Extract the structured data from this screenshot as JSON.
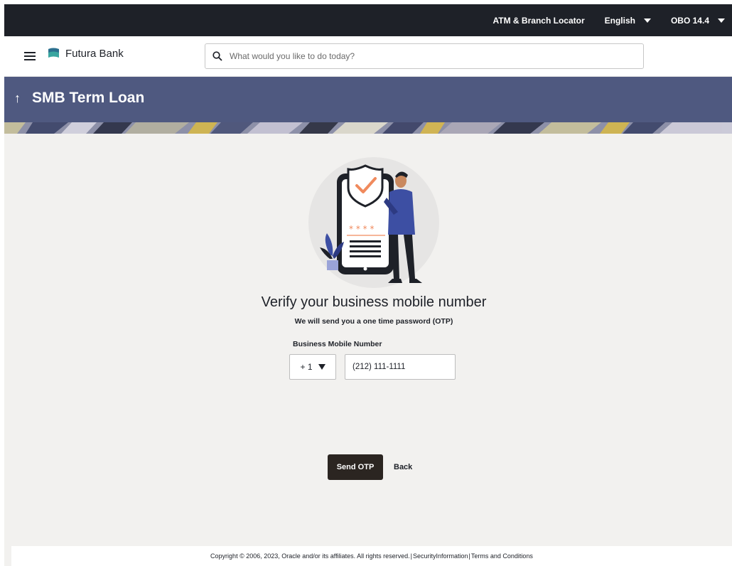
{
  "topbar": {
    "atm_locator": "ATM & Branch Locator",
    "language": "English",
    "obo": "OBO 14.4"
  },
  "header": {
    "brand": "Futura Bank",
    "search_placeholder": "What would you like to do today?"
  },
  "banner": {
    "title": "SMB Term Loan"
  },
  "main": {
    "heading": "Verify your business mobile number",
    "subtext": "We will send you a one time password (OTP)",
    "field_label": "Business Mobile Number",
    "country_code": "+ 1",
    "mobile_value": "(212) 111-1111",
    "send_otp_label": "Send OTP",
    "back_label": "Back"
  },
  "footer": {
    "copyright": "Copyright © 2006, 2023, Oracle and/or its affiliates. All rights reserved.",
    "security": "SecurityInformation",
    "terms": "Terms and Conditions"
  },
  "colors": {
    "topbar": "#1e2128",
    "banner": "#4f5980",
    "primary_button": "#2b2521",
    "accent": "#f08a5d",
    "figure_blue": "#3d4fa3"
  },
  "icons": [
    "hamburger-icon",
    "bank-logo-icon",
    "search-icon",
    "arrow-up-icon",
    "chevron-down-icon",
    "shield-check-icon"
  ]
}
